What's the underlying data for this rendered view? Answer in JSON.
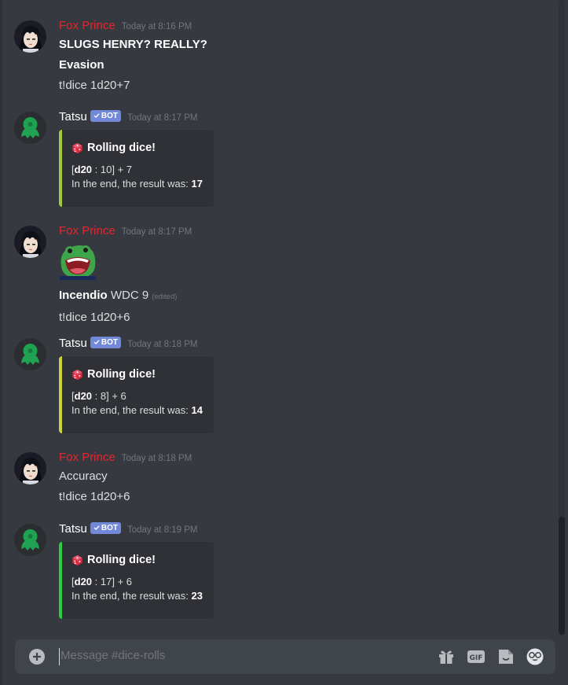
{
  "messages": [
    {
      "author": "Fox Prince",
      "timestamp": "Today at 8:16 PM",
      "lines": [
        "SLUGS HENRY? REALLY?",
        "Evasion",
        "t!dice 1d20+7"
      ]
    },
    {
      "author": "Tatsu",
      "bot_tag": "BOT",
      "timestamp": "Today at 8:17 PM",
      "embed": {
        "title": "Rolling dice!",
        "die": "d20",
        "roll": "10",
        "modifier": "+ 7",
        "result_prefix": "In the end, the result was:",
        "result": "17",
        "accent": "#a3c93a"
      }
    },
    {
      "author": "Fox Prince",
      "timestamp": "Today at 8:17 PM",
      "emoji": "frog-emoji",
      "lines_bold_prefix": "Incendio",
      "line_rest": "WDC 9",
      "edited": "(edited)",
      "lines": [
        "t!dice 1d20+6"
      ]
    },
    {
      "author": "Tatsu",
      "bot_tag": "BOT",
      "timestamp": "Today at 8:18 PM",
      "embed": {
        "title": "Rolling dice!",
        "die": "d20",
        "roll": "8",
        "modifier": "+ 6",
        "result_prefix": "In the end, the result was:",
        "result": "14",
        "accent": "#cbd33b"
      }
    },
    {
      "author": "Fox Prince",
      "timestamp": "Today at 8:18 PM",
      "lines": [
        "Accuracy",
        "t!dice 1d20+6"
      ]
    },
    {
      "author": "Tatsu",
      "bot_tag": "BOT",
      "timestamp": "Today at 8:19 PM",
      "embed": {
        "title": "Rolling dice!",
        "die": "d20",
        "roll": "17",
        "modifier": "+ 6",
        "result_prefix": "In the end, the result was:",
        "result": "23",
        "accent": "#2ecc40"
      }
    }
  ],
  "composer": {
    "placeholder": "Message #dice-rolls",
    "gif_label": "GIF",
    "icons": [
      "add-icon",
      "gift-icon",
      "gif-icon",
      "sticker-icon",
      "emoji-icon"
    ]
  },
  "colors": {
    "background": "#36393f",
    "fox_username": "#e8242c",
    "bot_tag": "#7289da",
    "embed_bg": "#2f3136",
    "timestamp": "#72767d"
  }
}
